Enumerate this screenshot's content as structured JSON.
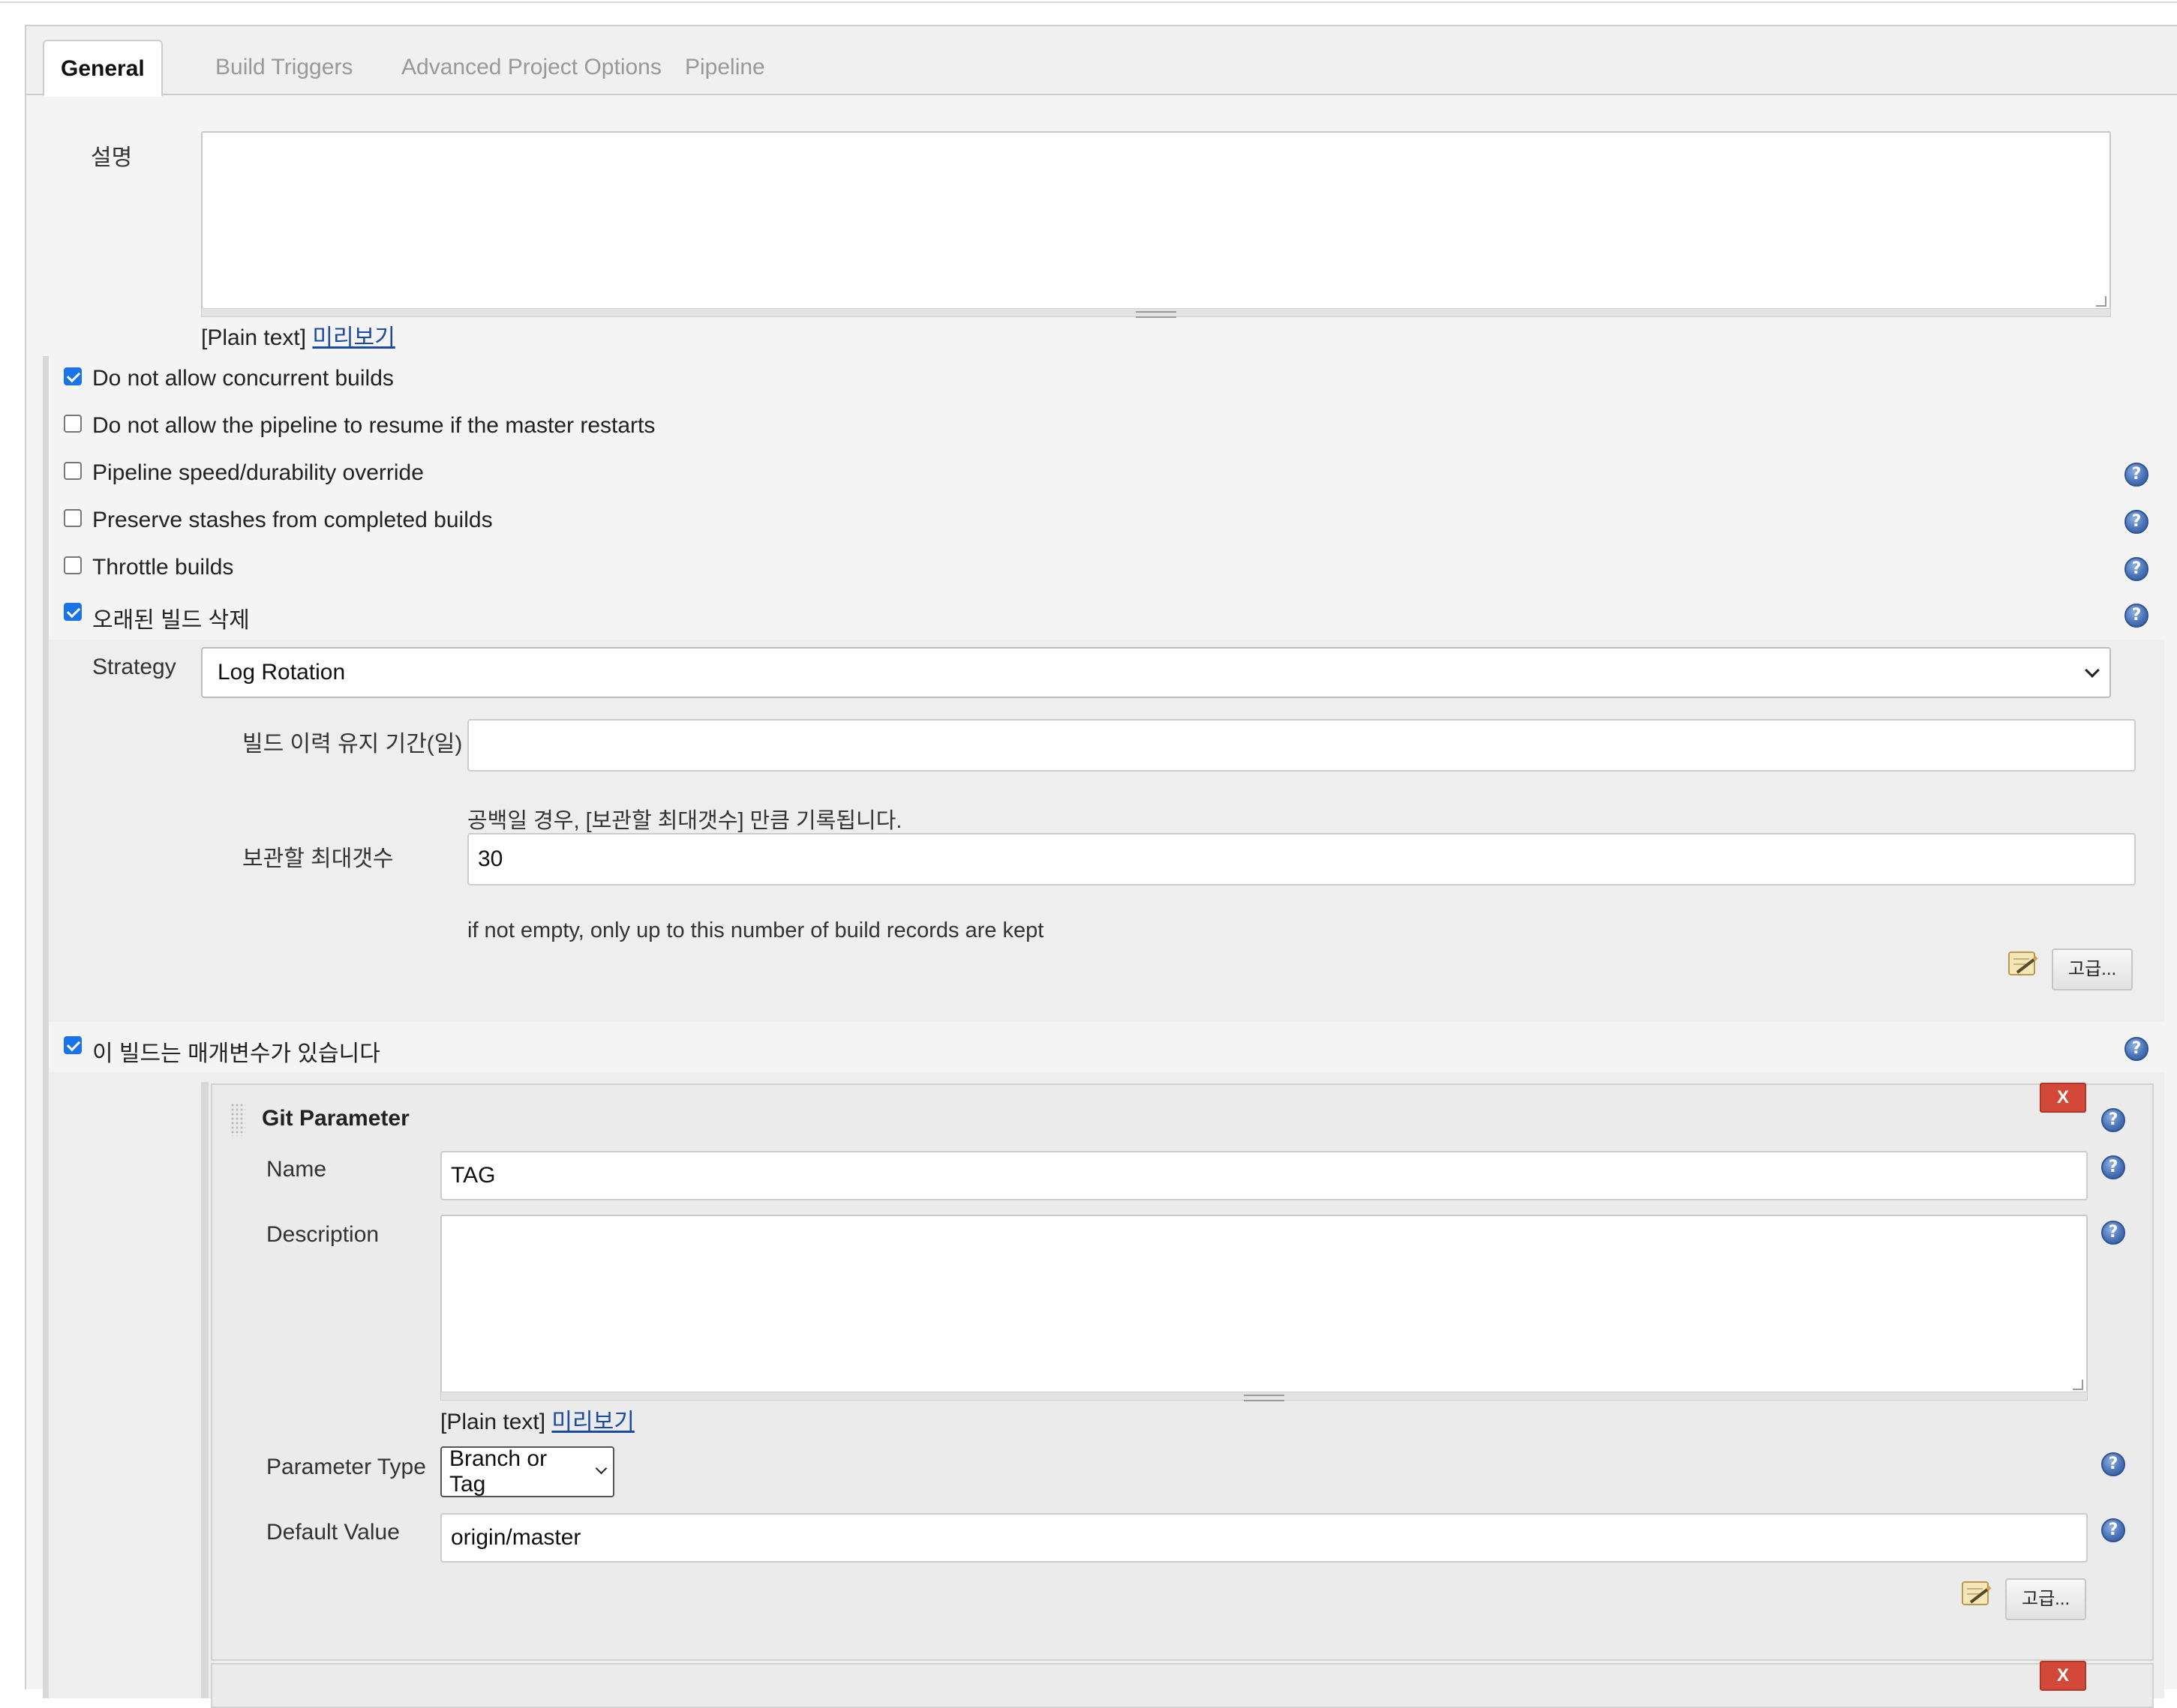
{
  "tabs": [
    {
      "label": "General",
      "active": true
    },
    {
      "label": "Build Triggers",
      "active": false
    },
    {
      "label": "Advanced Project Options",
      "active": false
    },
    {
      "label": "Pipeline",
      "active": false
    }
  ],
  "description": {
    "label": "설명",
    "value": "",
    "plain_text": "[Plain text]",
    "preview_link": "미리보기"
  },
  "options": [
    {
      "label": "Do not allow concurrent builds",
      "checked": true
    },
    {
      "label": "Do not allow the pipeline to resume if the master restarts",
      "checked": false
    },
    {
      "label": "Pipeline speed/durability override",
      "checked": false
    },
    {
      "label": "Preserve stashes from completed builds",
      "checked": false
    },
    {
      "label": "Throttle builds",
      "checked": false
    },
    {
      "label": "오래된 빌드 삭제",
      "checked": true
    }
  ],
  "discard": {
    "strategy_label": "Strategy",
    "strategy_value": "Log Rotation",
    "days_label": "빌드 이력 유지 기간(일)",
    "days_value": "",
    "days_help": "공백일 경우, [보관할 최대갯수] 만큼 기록됩니다.",
    "max_label": "보관할 최대갯수",
    "max_value": "30",
    "max_help": "if not empty, only up to this number of build records are kept",
    "advanced_button": "고급..."
  },
  "parameterized": {
    "label": "이 빌드는 매개변수가 있습니다",
    "checked": true
  },
  "git_parameter": {
    "title": "Git Parameter",
    "delete_button": "X",
    "name_label": "Name",
    "name_value": "TAG",
    "description_label": "Description",
    "description_value": "",
    "plain_text": "[Plain text]",
    "preview_link": "미리보기",
    "type_label": "Parameter Type",
    "type_value": "Branch or Tag",
    "default_label": "Default Value",
    "default_value": "origin/master",
    "advanced_button": "고급..."
  },
  "next_parameter": {
    "delete_button": "X"
  },
  "help_glyph": "?",
  "colors": {
    "accent_checkbox": "#1a73e8",
    "link": "#1a4ba0",
    "delete_button": "#d24939",
    "help_icon": "#4a73b8"
  }
}
